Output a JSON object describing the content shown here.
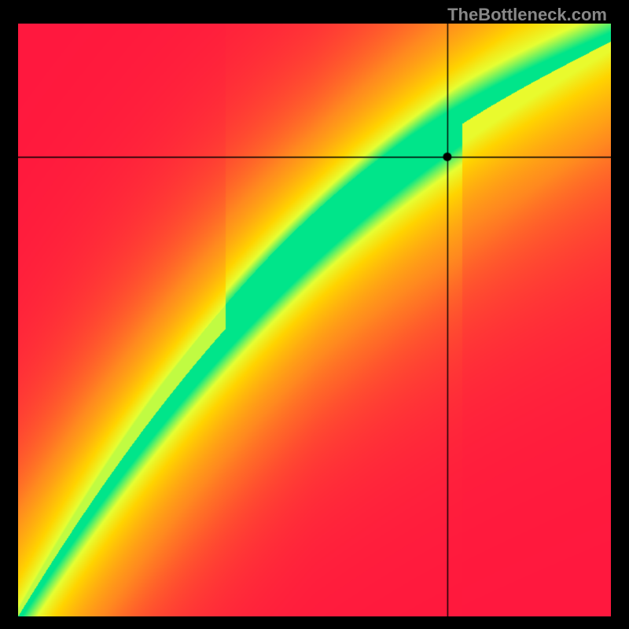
{
  "watermark": "TheBottleneck.com",
  "chart_data": {
    "type": "heatmap",
    "title": "",
    "xlabel": "",
    "ylabel": "",
    "xlim": [
      0,
      1
    ],
    "ylim": [
      0,
      1
    ],
    "crosshair": {
      "x": 0.725,
      "y": 0.775
    },
    "marker": {
      "x": 0.725,
      "y": 0.775
    },
    "colorscale": {
      "low": "#ff173e",
      "mid_low": "#ff8a1f",
      "mid": "#ffd400",
      "mid_high": "#e6ff33",
      "high": "#00e58a"
    },
    "optimal_curve_description": "S-shaped green optimal band from bottom-left to top-right; background gradient from red (far from curve) through orange/yellow to green (on curve)"
  }
}
